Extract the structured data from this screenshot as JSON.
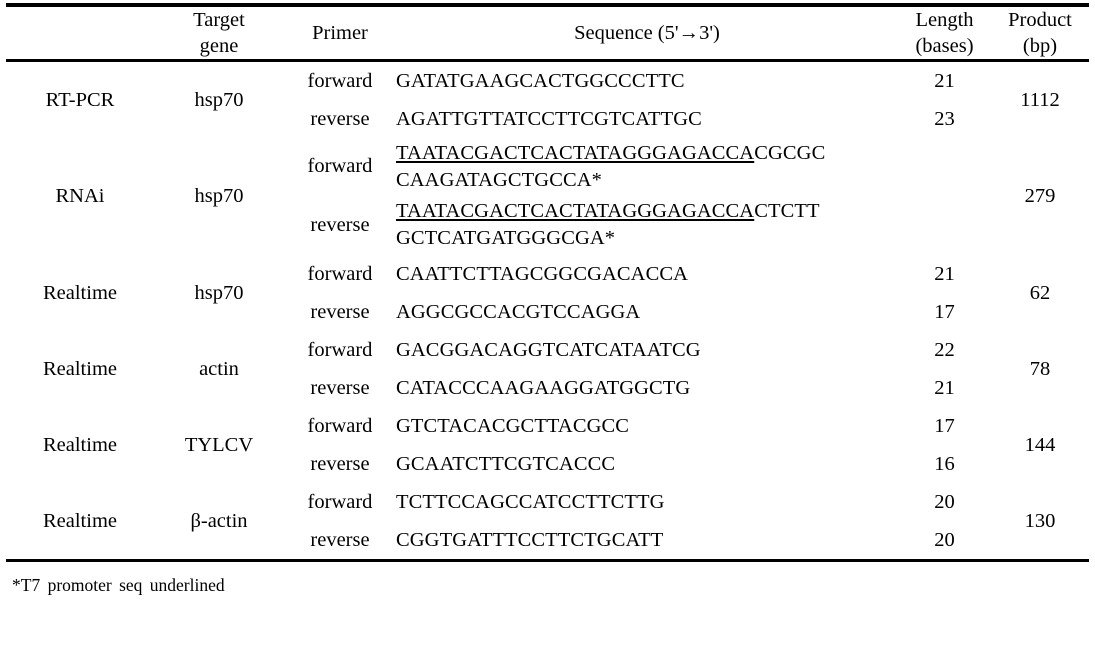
{
  "table": {
    "columns": {
      "assay": "",
      "target_gene": {
        "line1": "Target",
        "line2": "gene"
      },
      "primer": "Primer",
      "sequence": "Sequence  (5'→3')",
      "length": {
        "line1": "Length",
        "line2": "(bases)"
      },
      "product": {
        "line1": "Product",
        "line2": "(bp)"
      }
    },
    "groups": [
      {
        "assay": "RT-PCR",
        "gene": "hsp70",
        "product": "1112",
        "rows": [
          {
            "primer": "forward",
            "sequence_parts": [
              {
                "text": "GATATGAAGCACTGGCCCTTC",
                "underlined": false
              }
            ],
            "length": "21"
          },
          {
            "primer": "reverse",
            "sequence_parts": [
              {
                "text": "AGATTGTTATCCTTCGTCATTGC",
                "underlined": false
              }
            ],
            "length": "23"
          }
        ]
      },
      {
        "assay": "RNAi",
        "gene": "hsp70",
        "product": "279",
        "rows": [
          {
            "primer": "forward",
            "sequence_lines": [
              [
                {
                  "text": "TAATACGACTCACTATAGGGAGACCA",
                  "underlined": true
                },
                {
                  "text": "CGCGC",
                  "underlined": false
                }
              ],
              [
                {
                  "text": "CAAGATAGCTGCCA*",
                  "underlined": false
                }
              ]
            ],
            "length": ""
          },
          {
            "primer": "reverse",
            "sequence_lines": [
              [
                {
                  "text": "TAATACGACTCACTATAGGGAGACCA",
                  "underlined": true
                },
                {
                  "text": "CTCTT",
                  "underlined": false
                }
              ],
              [
                {
                  "text": "GCTCATGATGGGCGA*",
                  "underlined": false
                }
              ]
            ],
            "length": ""
          }
        ]
      },
      {
        "assay": "Realtime",
        "gene": "hsp70",
        "product": "62",
        "rows": [
          {
            "primer": "forward",
            "sequence_parts": [
              {
                "text": "CAATTCTTAGCGGCGACACCA",
                "underlined": false
              }
            ],
            "length": "21"
          },
          {
            "primer": "reverse",
            "sequence_parts": [
              {
                "text": "AGGCGCCACGTCCAGGA",
                "underlined": false
              }
            ],
            "length": "17"
          }
        ]
      },
      {
        "assay": "Realtime",
        "gene": "actin",
        "product": "78",
        "rows": [
          {
            "primer": "forward",
            "sequence_parts": [
              {
                "text": "GACGGACAGGTCATCATAATCG",
                "underlined": false
              }
            ],
            "length": "22"
          },
          {
            "primer": "reverse",
            "sequence_parts": [
              {
                "text": "CATACCCAAGAAGGATGGCTG",
                "underlined": false
              }
            ],
            "length": "21"
          }
        ]
      },
      {
        "assay": "Realtime",
        "gene": "TYLCV",
        "product": "144",
        "rows": [
          {
            "primer": "forward",
            "sequence_parts": [
              {
                "text": "GTCTACACGCTTACGCC",
                "underlined": false
              }
            ],
            "length": "17"
          },
          {
            "primer": "reverse",
            "sequence_parts": [
              {
                "text": "GCAATCTTCGTCACCC",
                "underlined": false
              }
            ],
            "length": "16"
          }
        ]
      },
      {
        "assay": "Realtime",
        "gene": "β-actin",
        "product": "130",
        "rows": [
          {
            "primer": "forward",
            "sequence_parts": [
              {
                "text": "TCTTCCAGCCATCCTTCTTG",
                "underlined": false
              }
            ],
            "length": "20"
          },
          {
            "primer": "reverse",
            "sequence_parts": [
              {
                "text": "CGGTGATTTCCTTCTGCATT",
                "underlined": false
              }
            ],
            "length": "20"
          }
        ]
      }
    ]
  },
  "footnote": "*T7  promoter  seq  underlined"
}
